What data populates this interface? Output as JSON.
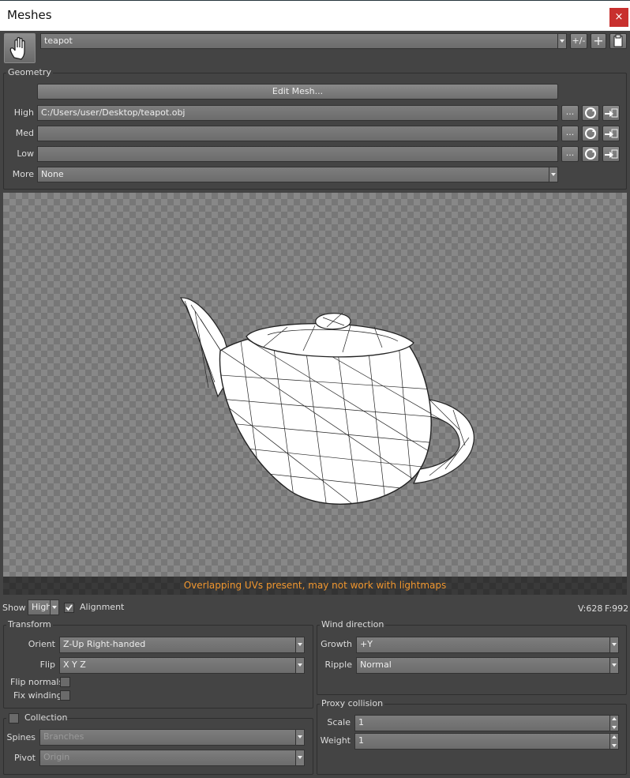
{
  "window": {
    "title": "Meshes",
    "close_label": "×"
  },
  "toolbar": {
    "mesh_name": "teapot",
    "plusminus_label": "+/-",
    "add_label": "+"
  },
  "geometry": {
    "group_label": "Geometry",
    "edit_mesh_label": "Edit Mesh...",
    "browse_label": "...",
    "high": {
      "label": "High",
      "value": "C:/Users/user/Desktop/teapot.obj"
    },
    "med": {
      "label": "Med",
      "value": ""
    },
    "low": {
      "label": "Low",
      "value": ""
    },
    "more": {
      "label": "More",
      "value": "None"
    }
  },
  "viewport": {
    "warning": "Overlapping UVs present, may not work with lightmaps"
  },
  "statusbar": {
    "show_label": "Show",
    "show_value": "High",
    "alignment_label": "Alignment",
    "alignment_checked": true,
    "vertex_count": "V:628",
    "face_count": "F:992"
  },
  "transform": {
    "group_label": "Transform",
    "orient_label": "Orient",
    "orient_value": "Z-Up Right-handed",
    "flip_label": "Flip",
    "flip_value": "X Y Z",
    "flip_normals_label": "Flip normals",
    "fix_winding_label": "Fix winding"
  },
  "wind": {
    "group_label": "Wind direction",
    "growth_label": "Growth",
    "growth_value": "+Y",
    "ripple_label": "Ripple",
    "ripple_value": "Normal"
  },
  "collection": {
    "group_label": "Collection",
    "spines_label": "Spines",
    "spines_value": "Branches",
    "pivot_label": "Pivot",
    "pivot_value": "Origin"
  },
  "proxy": {
    "group_label": "Proxy collision",
    "scale_label": "Scale",
    "scale_value": "1",
    "weight_label": "Weight",
    "weight_value": "1"
  },
  "colors": {
    "warning": "#f0962e",
    "close": "#c8302e",
    "panel": "#444444"
  }
}
